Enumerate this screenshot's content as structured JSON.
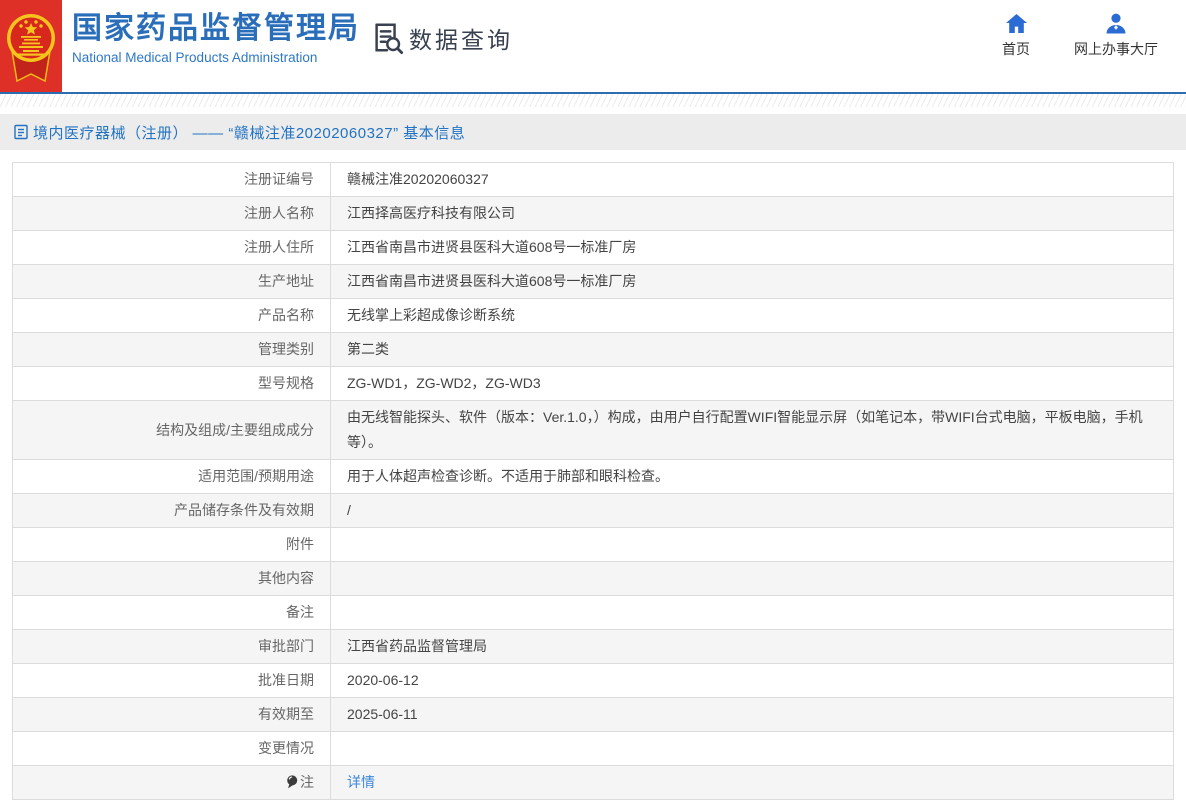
{
  "header": {
    "brand": {
      "title_cn": "国家药品监督管理局",
      "title_en": "National Medical Products Administration",
      "emblem": "china-national-emblem"
    },
    "section_title": "数据查询",
    "nav": [
      {
        "label": "首页",
        "icon": "home-icon"
      },
      {
        "label": "网上办事大厅",
        "icon": "user-icon"
      }
    ]
  },
  "breadcrumb": {
    "icon": "document-icon",
    "text": "境内医疗器械（注册） —— “赣械注准20202060327” 基本信息"
  },
  "detail_table": {
    "rows": [
      {
        "label": "注册证编号",
        "value": "赣械注准20202060327"
      },
      {
        "label": "注册人名称",
        "value": "江西择高医疗科技有限公司"
      },
      {
        "label": "注册人住所",
        "value": "江西省南昌市进贤县医科大道608号一标准厂房"
      },
      {
        "label": "生产地址",
        "value": "江西省南昌市进贤县医科大道608号一标准厂房"
      },
      {
        "label": "产品名称",
        "value": "无线掌上彩超成像诊断系统"
      },
      {
        "label": "管理类别",
        "value": "第二类"
      },
      {
        "label": "型号规格",
        "value": "ZG-WD1，ZG-WD2，ZG-WD3"
      },
      {
        "label": "结构及组成/主要组成成分",
        "value": "由无线智能探头、软件（版本：Ver.1.0，）构成，由用户自行配置WIFI智能显示屏（如笔记本，带WIFI台式电脑，平板电脑，手机等）。"
      },
      {
        "label": "适用范围/预期用途",
        "value": "用于人体超声检查诊断。不适用于肺部和眼科检查。"
      },
      {
        "label": "产品储存条件及有效期",
        "value": "/"
      },
      {
        "label": "附件",
        "value": ""
      },
      {
        "label": "其他内容",
        "value": ""
      },
      {
        "label": "备注",
        "value": ""
      },
      {
        "label": "审批部门",
        "value": "江西省药品监督管理局"
      },
      {
        "label": "批准日期",
        "value": "2020-06-12"
      },
      {
        "label": "有效期至",
        "value": "2025-06-11"
      },
      {
        "label": "变更情况",
        "value": ""
      },
      {
        "label": "注",
        "value": "详情",
        "value_is_link": true,
        "label_icon": "balloon-icon"
      }
    ]
  },
  "colors": {
    "brand_blue": "#2a6db9",
    "emblem_red": "#de3027",
    "rule_blue": "#2b6cb3",
    "crumb_bg": "#ececec",
    "crumb_text": "#2273c3",
    "nav_icon_blue": "#2b6bd4",
    "table_border": "#dcdcdc",
    "row_alt_bg": "#f5f5f5",
    "link_blue": "#3a87d8"
  }
}
